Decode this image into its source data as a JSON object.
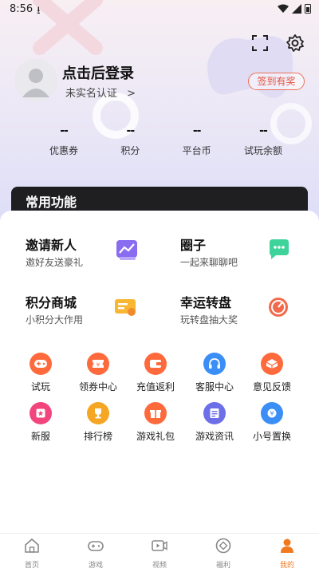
{
  "status_bar": {
    "time": "8:56",
    "download_glyph": "⭳"
  },
  "header": {
    "scan_icon": "scan-icon",
    "settings_icon": "gear-icon"
  },
  "profile": {
    "login_text": "点击后登录",
    "auth_text": "未实名认证",
    "auth_arrow": ">",
    "checkin_label": "签到有奖"
  },
  "stats": [
    {
      "value": "--",
      "label": "优惠券"
    },
    {
      "value": "--",
      "label": "积分"
    },
    {
      "value": "--",
      "label": "平台币"
    },
    {
      "value": "--",
      "label": "试玩余额"
    }
  ],
  "common_functions": {
    "title": "常用功能"
  },
  "features": [
    {
      "title": "邀请新人",
      "subtitle": "邀好友送豪礼",
      "icon": "chart-card-icon"
    },
    {
      "title": "圈子",
      "subtitle": "一起来聊聊吧",
      "icon": "chat-bubble-icon"
    },
    {
      "title": "积分商城",
      "subtitle": "小积分大作用",
      "icon": "coupon-card-icon"
    },
    {
      "title": "幸运转盘",
      "subtitle": "玩转盘抽大奖",
      "icon": "wheel-icon"
    }
  ],
  "grid": [
    {
      "label": "试玩",
      "icon": "gamepad-icon",
      "color": "#ff6a3d"
    },
    {
      "label": "领券中心",
      "icon": "ticket-icon",
      "color": "#ff6a3d"
    },
    {
      "label": "充值返利",
      "icon": "wallet-icon",
      "color": "#ff6a3d"
    },
    {
      "label": "客服中心",
      "icon": "headset-icon",
      "color": "#3a8ef5"
    },
    {
      "label": "意见反馈",
      "icon": "feedback-box-icon",
      "color": "#ff6a3d"
    },
    {
      "label": "新服",
      "icon": "star-badge-icon",
      "color": "#f2457e"
    },
    {
      "label": "排行榜",
      "icon": "trophy-icon",
      "color": "#f5a623"
    },
    {
      "label": "游戏礼包",
      "icon": "gift-icon",
      "color": "#ff6a3d"
    },
    {
      "label": "游戏资讯",
      "icon": "news-icon",
      "color": "#6d6fe8"
    },
    {
      "label": "小号置换",
      "icon": "exchange-icon",
      "color": "#3a8ef5"
    }
  ],
  "tabs": [
    {
      "label": "首页",
      "icon": "home-icon",
      "active": false
    },
    {
      "label": "游戏",
      "icon": "controller-icon",
      "active": false
    },
    {
      "label": "视频",
      "icon": "video-icon",
      "active": false
    },
    {
      "label": "福利",
      "icon": "welfare-icon",
      "active": false
    },
    {
      "label": "我的",
      "icon": "person-icon",
      "active": true
    }
  ],
  "colors": {
    "accent": "#f07a20",
    "checkin": "#e8503a",
    "panel_dark": "#1f1f22"
  }
}
